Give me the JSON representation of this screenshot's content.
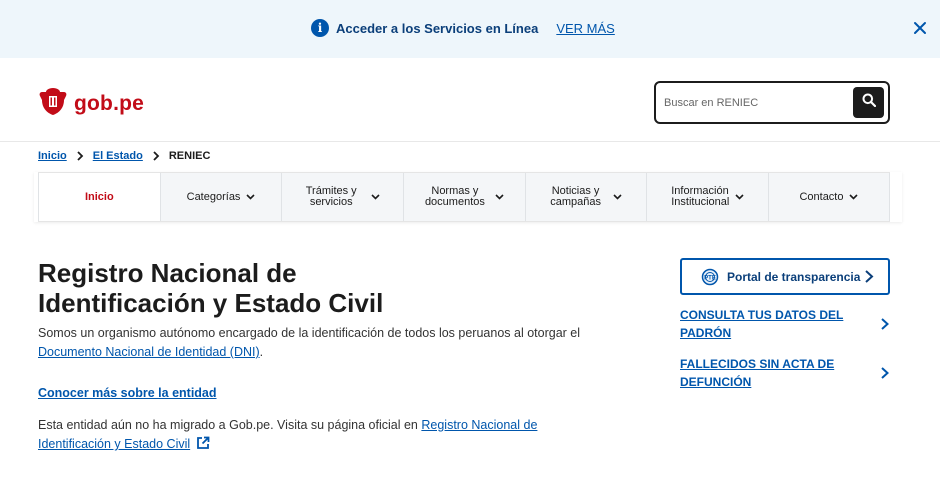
{
  "banner": {
    "text": "Acceder a los Servicios en Línea",
    "link": "VER MÁS",
    "info_icon": "i"
  },
  "header": {
    "logo_text": "gob.pe",
    "search_placeholder": "Buscar en RENIEC"
  },
  "breadcrumb": {
    "items": [
      "Inicio",
      "El Estado"
    ],
    "current": "RENIEC"
  },
  "nav": {
    "items": [
      {
        "label": "Inicio"
      },
      {
        "label": "Categorías"
      },
      {
        "label_1": "Trámites y",
        "label_2": "servicios"
      },
      {
        "label_1": "Normas y",
        "label_2": "documentos"
      },
      {
        "label_1": "Noticias y",
        "label_2": "campañas"
      },
      {
        "label_1": "Información",
        "label_2": "Institucional"
      },
      {
        "label": "Contacto"
      }
    ]
  },
  "main": {
    "title_line1": "Registro Nacional de",
    "title_line2": "Identificación y Estado Civil",
    "desc_text": "Somos un organismo autónomo encargado de la identificación de todos los peruanos al otorgar el ",
    "desc_link": "Documento Nacional de Identidad (DNI)",
    "desc_end": ".",
    "more_link": "Conocer más sobre la entidad",
    "migrated_text": "Esta entidad aún no ha migrado a Gob.pe. Visita su página oficial en ",
    "migrated_link": "Registro Nacional de Identificación y Estado Civil"
  },
  "sidebar": {
    "portal_label": "Portal de transparencia",
    "links": [
      {
        "line1": "CONSULTA TUS DATOS DEL",
        "line2": "PADRÓN"
      },
      {
        "line1": "FALLECIDOS SIN ACTA DE",
        "line2": "DEFUNCIÓN"
      }
    ]
  },
  "colors": {
    "brand_red": "#c20c18",
    "link_blue": "#0056ac",
    "banner_bg": "#eef6fb"
  }
}
